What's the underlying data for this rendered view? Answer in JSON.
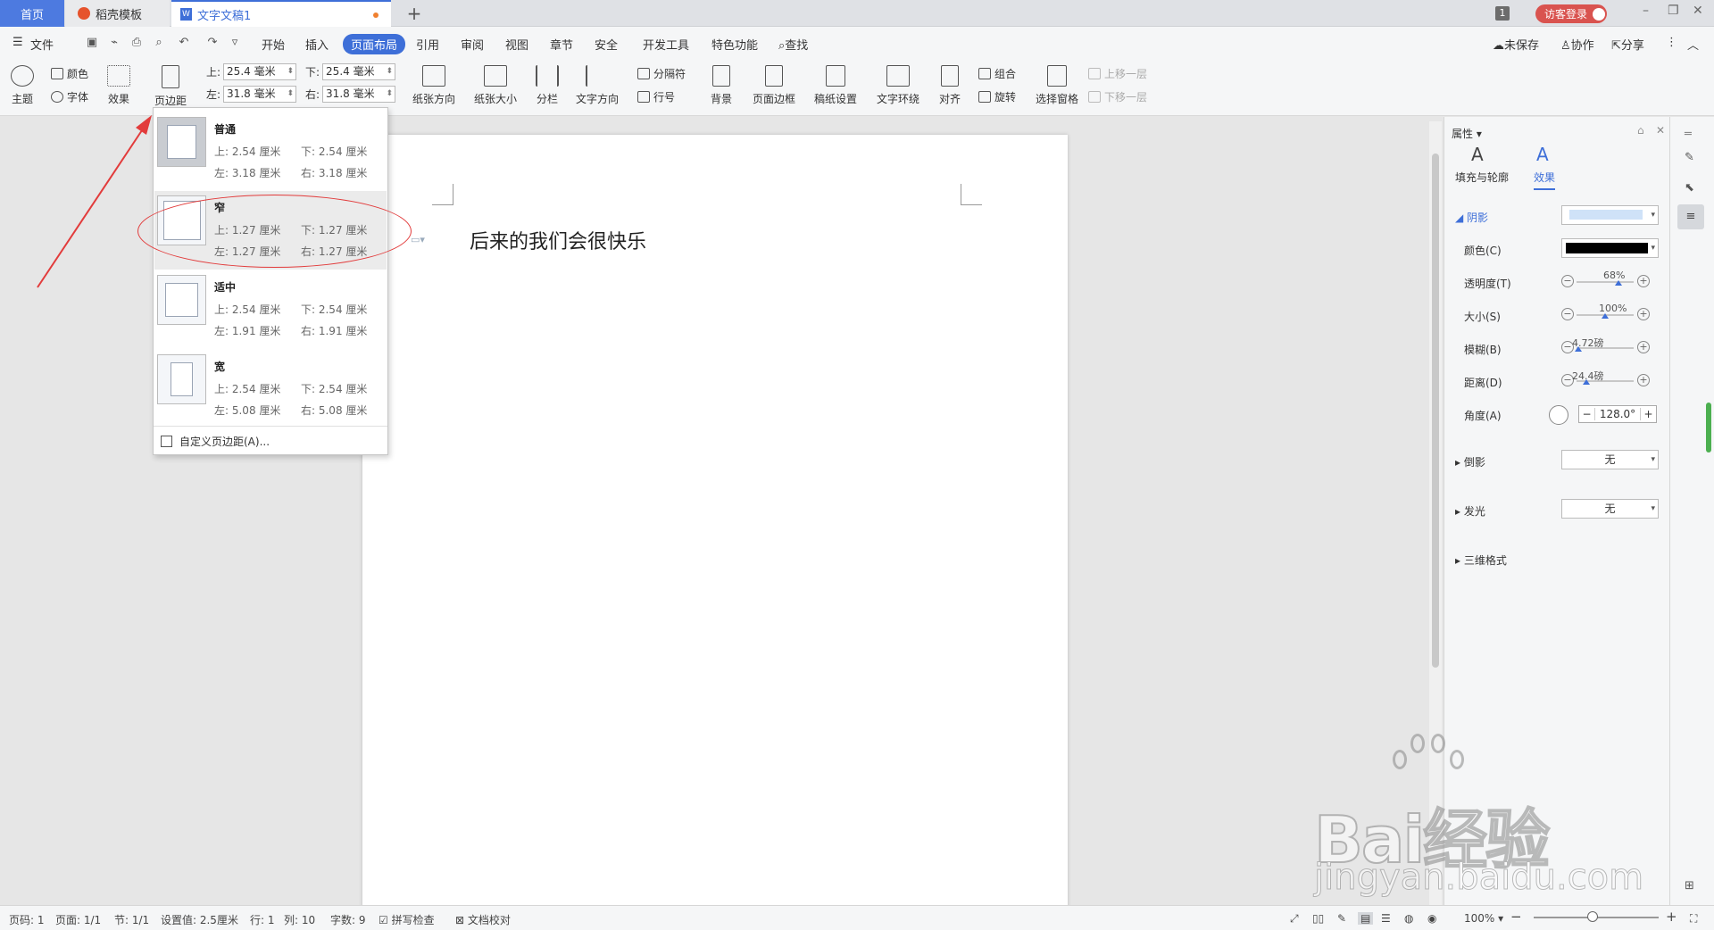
{
  "tabs": {
    "home": "首页",
    "template": "稻壳模板",
    "document": "文字文稿1",
    "add": "+"
  },
  "titlebar": {
    "window_count": "1",
    "login": "访客登录",
    "minimize": "–",
    "restore": "❐",
    "close": "✕"
  },
  "menu": {
    "file": "文件",
    "start": "开始",
    "insert": "插入",
    "page_layout": "页面布局",
    "reference": "引用",
    "review": "审阅",
    "view": "视图",
    "section": "章节",
    "security": "安全",
    "dev_tools": "开发工具",
    "features": "特色功能",
    "search": "查找",
    "unsaved": "未保存",
    "collab": "协作",
    "share": "分享"
  },
  "ribbon": {
    "theme": "主题",
    "color": "颜色",
    "font": "字体",
    "effect": "效果",
    "margin": "页边距",
    "margin_top_label": "上:",
    "margin_top": "25.4 毫米",
    "margin_bottom_label": "下:",
    "margin_bottom": "25.4 毫米",
    "margin_left_label": "左:",
    "margin_left": "31.8 毫米",
    "margin_right_label": "右:",
    "margin_right": "31.8 毫米",
    "orientation": "纸张方向",
    "paper_size": "纸张大小",
    "columns": "分栏",
    "text_direction": "文字方向",
    "separator": "分隔符",
    "line_number": "行号",
    "background": "背景",
    "page_border": "页面边框",
    "manuscript": "稿纸设置",
    "text_wrap": "文字环绕",
    "align": "对齐",
    "group": "组合",
    "rotate": "旋转",
    "selection_pane": "选择窗格",
    "bring_forward": "上移一层",
    "send_backward": "下移一层"
  },
  "dropdown": {
    "options": [
      {
        "name": "普通",
        "top": "上: 2.54 厘米",
        "bottom": "下: 2.54 厘米",
        "left": "左: 3.18 厘米",
        "right": "右: 3.18 厘米"
      },
      {
        "name": "窄",
        "top": "上: 1.27 厘米",
        "bottom": "下: 1.27 厘米",
        "left": "左: 1.27 厘米",
        "right": "右: 1.27 厘米"
      },
      {
        "name": "适中",
        "top": "上: 2.54 厘米",
        "bottom": "下: 2.54 厘米",
        "left": "左: 1.91 厘米",
        "right": "右: 1.91 厘米"
      },
      {
        "name": "宽",
        "top": "上: 2.54 厘米",
        "bottom": "下: 2.54 厘米",
        "left": "左: 5.08 厘米",
        "right": "右: 5.08 厘米"
      }
    ],
    "custom": "自定义页边距(A)..."
  },
  "document": {
    "text": "后来的我们会很快乐"
  },
  "panel": {
    "title": "属性",
    "tab_fill": "填充与轮廓",
    "tab_effect": "效果",
    "shadow": "阴影",
    "color": "颜色(C)",
    "transparency": "透明度(T)",
    "transparency_value": "68%",
    "transparency_level": 0.68,
    "size": "大小(S)",
    "size_value": "100%",
    "size_level": 1.0,
    "blur": "模糊(B)",
    "blur_value": "4.72磅",
    "distance": "距离(D)",
    "distance_value": "24.4磅",
    "angle": "角度(A)",
    "angle_value": "128.0°",
    "reflection": "倒影",
    "reflection_value": "无",
    "glow": "发光",
    "glow_value": "无",
    "three_d": "三维格式"
  },
  "status": {
    "page_no": "页码: 1",
    "page": "页面: 1/1",
    "section": "节: 1/1",
    "setting": "设置值: 2.5厘米",
    "row": "行: 1",
    "col": "列: 10",
    "words": "字数: 9",
    "spell": "拼写检查",
    "proof": "文档校对",
    "zoom": "100%"
  },
  "watermark": {
    "brand": "Bai经验",
    "url": "jingyan.baidu.com"
  }
}
